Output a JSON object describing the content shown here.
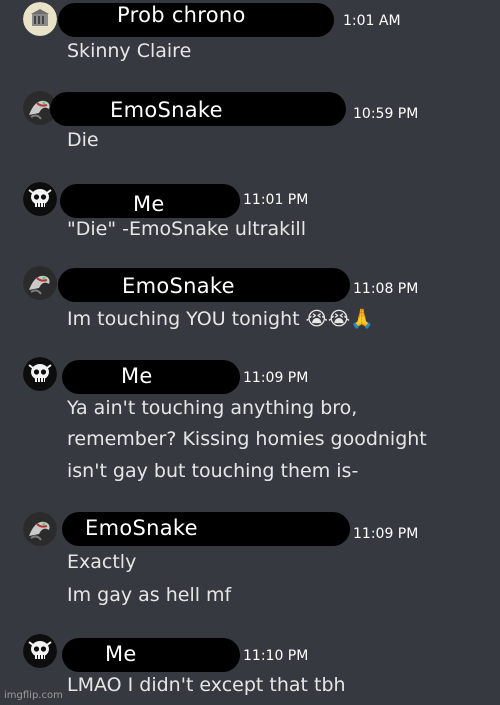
{
  "messages": [
    {
      "author": "Prob chrono",
      "time": "1:01 AM",
      "lines": [
        "Skinny Claire"
      ]
    },
    {
      "author": "EmoSnake",
      "time": "10:59 PM",
      "lines": [
        "Die"
      ]
    },
    {
      "author": "Me",
      "time": "11:01 PM",
      "lines": [
        "\"Die\" -EmoSnake ultrakill"
      ]
    },
    {
      "author": "EmoSnake",
      "time": "11:08 PM",
      "lines": [
        "Im touching YOU tonight 😭😭🙏"
      ]
    },
    {
      "author": "Me",
      "time": "11:09 PM",
      "lines": [
        "Ya ain't touching anything bro,",
        "remember? Kissing homies goodnight",
        "isn't gay but touching them is-"
      ]
    },
    {
      "author": "EmoSnake",
      "time": "11:09 PM",
      "lines": [
        "Exactly",
        "Im gay as hell mf"
      ]
    },
    {
      "author": "Me",
      "time": "11:10 PM",
      "lines": [
        "LMAO I didn't except that tbh"
      ]
    }
  ],
  "watermark": "imgflip.com",
  "colors": {
    "background": "#36393f",
    "text": "#e6e6e6",
    "redaction": "#000000"
  }
}
